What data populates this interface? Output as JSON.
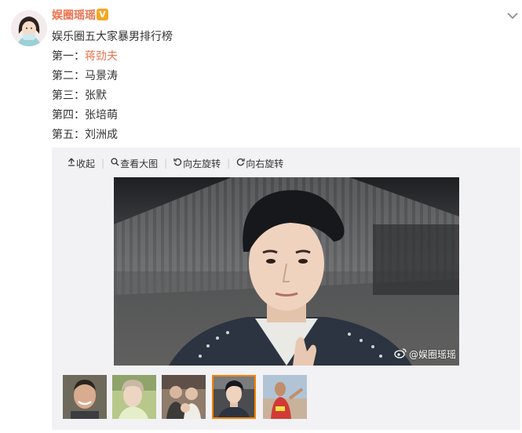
{
  "post": {
    "username": "娱圈瑶瑶",
    "verified_badge": "V",
    "title": "娱乐圈五大家暴男排行榜",
    "rank_lines": [
      {
        "prefix": "第一：",
        "name": "蒋劲夫",
        "is_link": true
      },
      {
        "prefix": "第二：",
        "name": "马景涛",
        "is_link": false
      },
      {
        "prefix": "第三：",
        "name": "张默",
        "is_link": false
      },
      {
        "prefix": "第四：",
        "name": "张培萌",
        "is_link": false
      },
      {
        "prefix": "第五：",
        "name": "刘洲成",
        "is_link": false
      }
    ],
    "link_color": "#eb7350"
  },
  "toolbar": {
    "collapse_label": "收起",
    "view_large_label": "查看大图",
    "rotate_left_label": "向左旋转",
    "rotate_right_label": "向右旋转"
  },
  "photo": {
    "watermark": "@娱圈瑶瑶",
    "description": ""
  },
  "thumbnails": {
    "count": 5,
    "active_index": 3,
    "active_color": "#ff8200"
  },
  "icons": [
    "chevron-down-icon",
    "collapse-arrow-icon",
    "magnifier-icon",
    "rotate-left-icon",
    "rotate-right-icon",
    "weibo-logo-icon"
  ]
}
